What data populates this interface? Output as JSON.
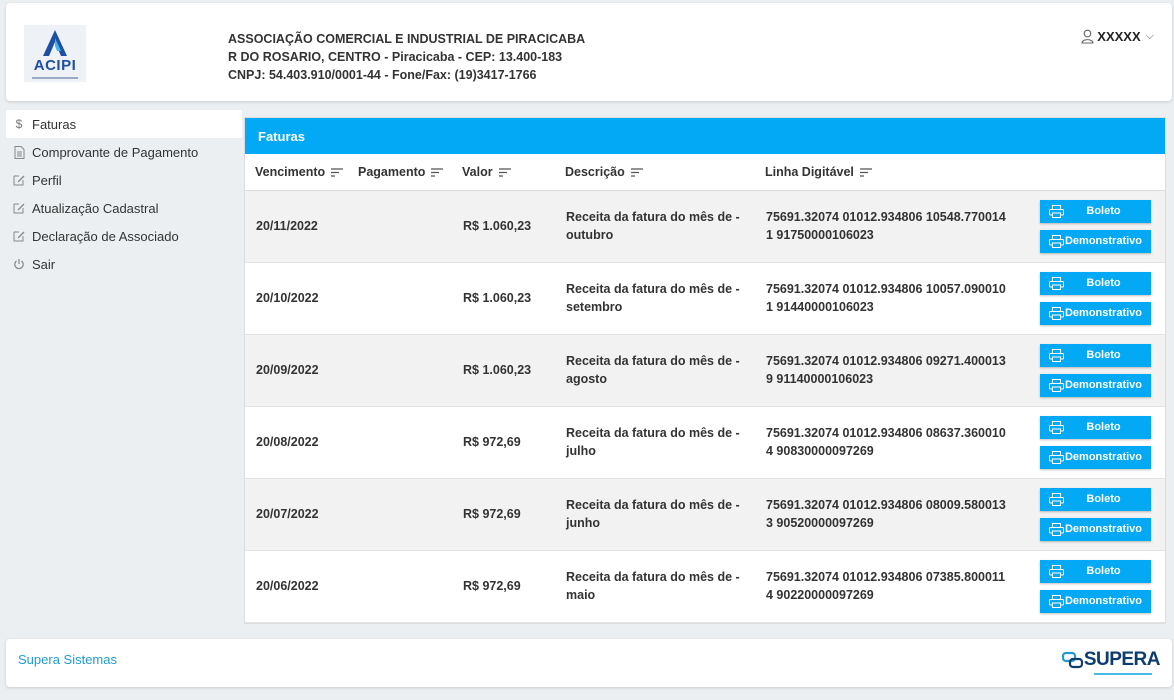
{
  "header": {
    "logo_text": "ACIPI",
    "company_name": "ASSOCIAÇÃO COMERCIAL E INDUSTRIAL DE PIRACICABA",
    "address": "R DO ROSARIO, CENTRO - Piracicaba - CEP: 13.400-183",
    "contact": "CNPJ: 54.403.910/0001-44 - Fone/Fax: (19)3417-1766",
    "user": "XXXXX"
  },
  "sidebar": {
    "items": [
      {
        "label": "Faturas",
        "icon": "dollar-icon"
      },
      {
        "label": "Comprovante de Pagamento",
        "icon": "document-icon"
      },
      {
        "label": "Perfil",
        "icon": "edit-icon"
      },
      {
        "label": "Atualização Cadastral",
        "icon": "edit-icon"
      },
      {
        "label": "Declaração de Associado",
        "icon": "edit-icon"
      },
      {
        "label": "Sair",
        "icon": "power-icon"
      }
    ]
  },
  "invoices": {
    "title": "Faturas",
    "columns": [
      "Vencimento",
      "Pagamento",
      "Valor",
      "Descrição",
      "Linha Digitável"
    ],
    "boleto_label": "Boleto",
    "demonstrativo_label": "Demonstrativo",
    "rows": [
      {
        "vencimento": "20/11/2022",
        "pagamento": "",
        "valor": "R$ 1.060,23",
        "descricao_l1": "Receita da fatura do mês de -",
        "descricao_l2": "outubro",
        "linha_l1": "75691.32074 01012.934806 10548.770014",
        "linha_l2": "1 91750000106023"
      },
      {
        "vencimento": "20/10/2022",
        "pagamento": "",
        "valor": "R$ 1.060,23",
        "descricao_l1": "Receita da fatura do mês de -",
        "descricao_l2": "setembro",
        "linha_l1": "75691.32074 01012.934806 10057.090010",
        "linha_l2": "1 91440000106023"
      },
      {
        "vencimento": "20/09/2022",
        "pagamento": "",
        "valor": "R$ 1.060,23",
        "descricao_l1": "Receita da fatura do mês de -",
        "descricao_l2": "agosto",
        "linha_l1": "75691.32074 01012.934806 09271.400013",
        "linha_l2": "9 91140000106023"
      },
      {
        "vencimento": "20/08/2022",
        "pagamento": "",
        "valor": "R$ 972,69",
        "descricao_l1": "Receita da fatura do mês de -",
        "descricao_l2": "julho",
        "linha_l1": "75691.32074 01012.934806 08637.360010",
        "linha_l2": "4 90830000097269"
      },
      {
        "vencimento": "20/07/2022",
        "pagamento": "",
        "valor": "R$ 972,69",
        "descricao_l1": "Receita da fatura do mês de -",
        "descricao_l2": "junho",
        "linha_l1": "75691.32074 01012.934806 08009.580013",
        "linha_l2": "3 90520000097269"
      },
      {
        "vencimento": "20/06/2022",
        "pagamento": "",
        "valor": "R$ 972,69",
        "descricao_l1": "Receita da fatura do mês de -",
        "descricao_l2": "maio",
        "linha_l1": "75691.32074 01012.934806 07385.800011",
        "linha_l2": "4 90220000097269"
      }
    ]
  },
  "footer": {
    "link": "Supera Sistemas",
    "brand": "SUPERA"
  },
  "colors": {
    "accent": "#03a9f4",
    "brand_dark": "#0e3c6e",
    "link": "#1f9bd1"
  }
}
